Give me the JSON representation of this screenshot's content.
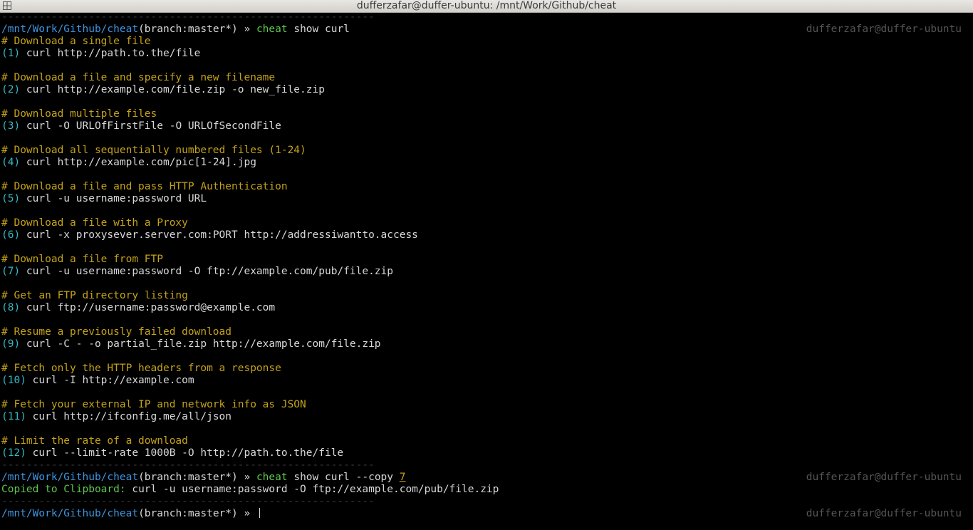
{
  "window": {
    "title": "dufferzafar@duffer-ubuntu: /mnt/Work/Github/cheat"
  },
  "prompt": {
    "path": "/mnt/Work/Github/cheat",
    "branch": "(branch:master*)",
    "arrow": " » ",
    "user_host": "dufferzafar@duffer-ubuntu"
  },
  "separator": "------------------------------------------------------------",
  "command1": {
    "cmd": "cheat",
    "args": " show curl"
  },
  "entries": [
    {
      "comment": "# Download a single file",
      "num": "(1)",
      "code": " curl http://path.to.the/file"
    },
    {
      "comment": "# Download a file and specify a new filename",
      "num": "(2)",
      "code": " curl http://example.com/file.zip -o new_file.zip"
    },
    {
      "comment": "# Download multiple files",
      "num": "(3)",
      "code": " curl -O URLOfFirstFile -O URLOfSecondFile"
    },
    {
      "comment": "# Download all sequentially numbered files (1-24)",
      "num": "(4)",
      "code": " curl http://example.com/pic[1-24].jpg"
    },
    {
      "comment": "# Download a file and pass HTTP Authentication",
      "num": "(5)",
      "code": " curl -u username:password URL"
    },
    {
      "comment": "# Download a file with a Proxy",
      "num": "(6)",
      "code": " curl -x proxysever.server.com:PORT http://addressiwantto.access"
    },
    {
      "comment": "# Download a file from FTP",
      "num": "(7)",
      "code": " curl -u username:password -O ftp://example.com/pub/file.zip"
    },
    {
      "comment": "# Get an FTP directory listing",
      "num": "(8)",
      "code": " curl ftp://username:password@example.com"
    },
    {
      "comment": "# Resume a previously failed download",
      "num": "(9)",
      "code": " curl -C - -o partial_file.zip http://example.com/file.zip"
    },
    {
      "comment": "# Fetch only the HTTP headers from a response",
      "num": "(10)",
      "code": " curl -I http://example.com"
    },
    {
      "comment": "# Fetch your external IP and network info as JSON",
      "num": "(11)",
      "code": " curl http://ifconfig.me/all/json"
    },
    {
      "comment": "# Limit the rate of a download",
      "num": "(12)",
      "code": " curl --limit-rate 1000B -O http://path.to.the/file"
    }
  ],
  "command2": {
    "cmd": "cheat",
    "args": " show curl --copy ",
    "arg_num": "7"
  },
  "copied": {
    "label": "Copied to Clipboard:",
    "text": " curl -u username:password -O ftp://example.com/pub/file.zip"
  },
  "colors": {
    "background": "#000000",
    "path": "#3d95e0",
    "command": "#5fc64f",
    "comment": "#c4a218",
    "number": "#36b8c4",
    "text": "#d8d8d8",
    "separator": "#3a3a3a",
    "user_host": "#555555"
  }
}
